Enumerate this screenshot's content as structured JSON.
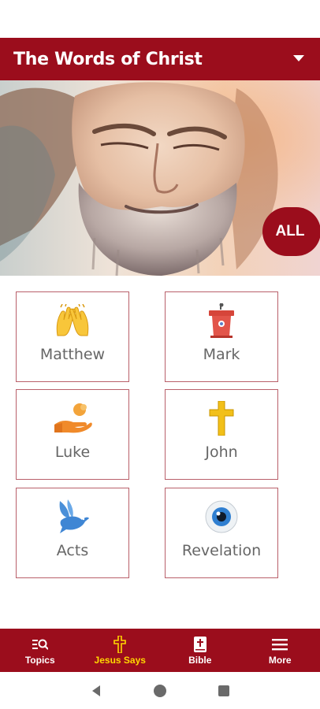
{
  "header": {
    "title": "The Words of Christ"
  },
  "hero": {
    "all_label": "ALL"
  },
  "books": [
    {
      "label": "Matthew",
      "icon": "raised-hands-icon"
    },
    {
      "label": "Mark",
      "icon": "podium-icon"
    },
    {
      "label": "Luke",
      "icon": "giving-hand-icon"
    },
    {
      "label": "John",
      "icon": "cross-icon"
    },
    {
      "label": "Acts",
      "icon": "dove-icon"
    },
    {
      "label": "Revelation",
      "icon": "eye-icon"
    }
  ],
  "nav": {
    "items": [
      {
        "label": "Topics",
        "icon": "topics-search-icon",
        "active": false
      },
      {
        "label": "Jesus Says",
        "icon": "cross-icon",
        "active": true
      },
      {
        "label": "Bible",
        "icon": "bible-icon",
        "active": false
      },
      {
        "label": "More",
        "icon": "menu-icon",
        "active": false
      }
    ]
  },
  "colors": {
    "primary": "#9b0d1c",
    "active_nav": "#ffd700",
    "tile_border": "#b9606a"
  }
}
